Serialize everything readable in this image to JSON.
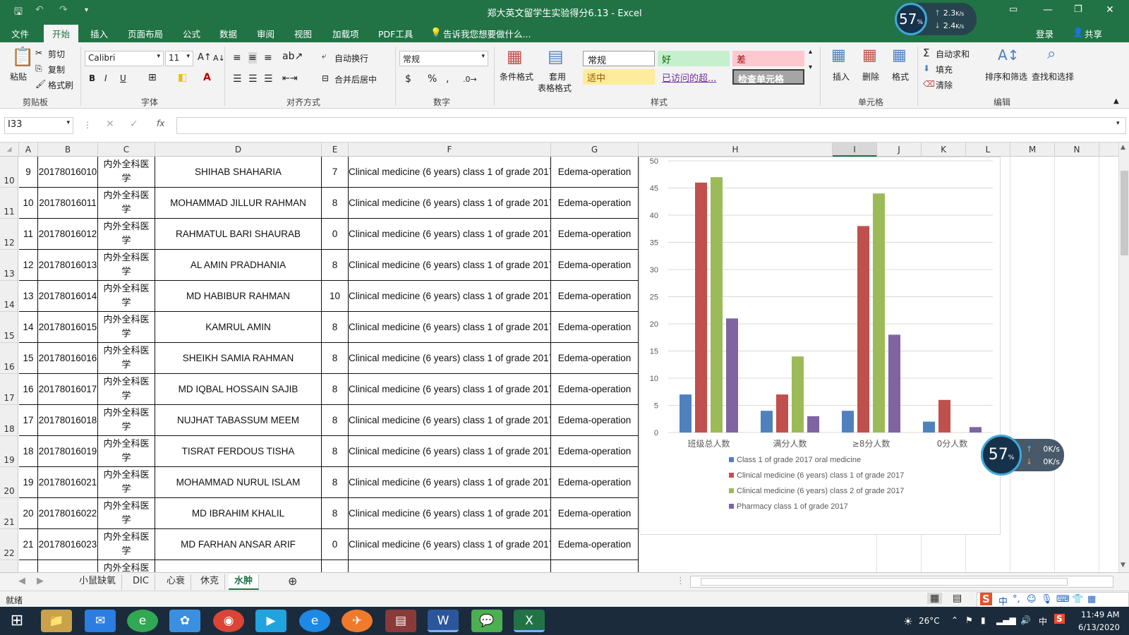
{
  "title_bar": {
    "window_title": "郑大英文留学生实验得分6.13 - Excel",
    "login": "登录",
    "share": "共享"
  },
  "ribbon_tabs": [
    "文件",
    "开始",
    "插入",
    "页面布局",
    "公式",
    "数据",
    "审阅",
    "视图",
    "加载项",
    "PDF工具"
  ],
  "tell_me": "告诉我您想要做什么...",
  "clipboard": {
    "paste": "粘贴",
    "cut": "剪切",
    "copy": "复制",
    "format_painter": "格式刷",
    "group": "剪贴板"
  },
  "font": {
    "name": "Calibri",
    "size": "11",
    "group": "字体",
    "bold": "B",
    "italic": "I",
    "underline": "U"
  },
  "alignment": {
    "wrap": "自动换行",
    "merge": "合并后居中",
    "group": "对齐方式"
  },
  "number": {
    "format": "常规",
    "group": "数字",
    "currency": "$",
    "percent": "%",
    "comma": ","
  },
  "styles_group": {
    "conditional": "条件格式",
    "table_format_1": "套用",
    "table_format_2": "表格格式",
    "normal": "常规",
    "good": "好",
    "bad": "差",
    "neutral": "适中",
    "visited": "已访问的超...",
    "check": "检查单元格",
    "group": "样式"
  },
  "cells": {
    "insert": "插入",
    "delete": "删除",
    "format": "格式",
    "group": "单元格"
  },
  "editing": {
    "autosum": "自动求和",
    "fill": "填充",
    "clear": "清除",
    "sort": "排序和筛选",
    "find": "查找和选择",
    "group": "编辑"
  },
  "formula_bar": {
    "name_box": "I33",
    "fx": "fx",
    "value": ""
  },
  "columns": [
    "A",
    "B",
    "C",
    "D",
    "E",
    "F",
    "G",
    "H",
    "I",
    "J",
    "K",
    "L",
    "M",
    "N"
  ],
  "rows": [
    {
      "row": "10",
      "a": "9",
      "b": "20178016010",
      "c1": "内外全科医",
      "c2": "学",
      "d": "SHIHAB SHAHARIA",
      "e": "7",
      "f": "Clinical medicine (6 years) class 1 of grade 2017",
      "g": "Edema-operation"
    },
    {
      "row": "11",
      "a": "10",
      "b": "20178016011",
      "c1": "内外全科医",
      "c2": "学",
      "d": "MOHAMMAD JILLUR RAHMAN",
      "e": "8",
      "f": "Clinical medicine (6 years) class 1 of grade 2017",
      "g": "Edema-operation"
    },
    {
      "row": "12",
      "a": "11",
      "b": "20178016012",
      "c1": "内外全科医",
      "c2": "学",
      "d": "RAHMATUL BARI SHAURAB",
      "e": "0",
      "f": "Clinical medicine (6 years) class 1 of grade 2017",
      "g": "Edema-operation"
    },
    {
      "row": "13",
      "a": "12",
      "b": "20178016013",
      "c1": "内外全科医",
      "c2": "学",
      "d": "AL AMIN PRADHANIA",
      "e": "8",
      "f": "Clinical medicine (6 years) class 1 of grade 2017",
      "g": "Edema-operation"
    },
    {
      "row": "14",
      "a": "13",
      "b": "20178016014",
      "c1": "内外全科医",
      "c2": "学",
      "d": "MD HABIBUR RAHMAN",
      "e": "10",
      "f": "Clinical medicine (6 years) class 1 of grade 2017",
      "g": "Edema-operation"
    },
    {
      "row": "15",
      "a": "14",
      "b": "20178016015",
      "c1": "内外全科医",
      "c2": "学",
      "d": "KAMRUL AMIN",
      "e": "8",
      "f": "Clinical medicine (6 years) class 1 of grade 2017",
      "g": "Edema-operation"
    },
    {
      "row": "16",
      "a": "15",
      "b": "20178016016",
      "c1": "内外全科医",
      "c2": "学",
      "d": "SHEIKH SAMIA RAHMAN",
      "e": "8",
      "f": "Clinical medicine (6 years) class 1 of grade 2017",
      "g": "Edema-operation"
    },
    {
      "row": "17",
      "a": "16",
      "b": "20178016017",
      "c1": "内外全科医",
      "c2": "学",
      "d": "MD IQBAL HOSSAIN SAJIB",
      "e": "8",
      "f": "Clinical medicine (6 years) class 1 of grade 2017",
      "g": "Edema-operation"
    },
    {
      "row": "18",
      "a": "17",
      "b": "20178016018",
      "c1": "内外全科医",
      "c2": "学",
      "d": "NUJHAT TABASSUM MEEM",
      "e": "8",
      "f": "Clinical medicine (6 years) class 1 of grade 2017",
      "g": "Edema-operation"
    },
    {
      "row": "19",
      "a": "18",
      "b": "20178016019",
      "c1": "内外全科医",
      "c2": "学",
      "d": "TISRAT FERDOUS TISHA",
      "e": "8",
      "f": "Clinical medicine (6 years) class 1 of grade 2017",
      "g": "Edema-operation"
    },
    {
      "row": "20",
      "a": "19",
      "b": "20178016021",
      "c1": "内外全科医",
      "c2": "学",
      "d": "MOHAMMAD NURUL ISLAM",
      "e": "8",
      "f": "Clinical medicine (6 years) class 1 of grade 2017",
      "g": "Edema-operation"
    },
    {
      "row": "21",
      "a": "20",
      "b": "20178016022",
      "c1": "内外全科医",
      "c2": "学",
      "d": "MD IBRAHIM KHALIL",
      "e": "8",
      "f": "Clinical medicine (6 years) class 1 of grade 2017",
      "g": "Edema-operation"
    },
    {
      "row": "22",
      "a": "21",
      "b": "20178016023",
      "c1": "内外全科医",
      "c2": "学",
      "d": "MD FARHAN ANSAR ARIF",
      "e": "0",
      "f": "Clinical medicine (6 years) class 1 of grade 2017",
      "g": "Edema-operation"
    },
    {
      "row": "",
      "a": "",
      "b": "",
      "c1": "内外全科医",
      "c2": "",
      "d": "",
      "e": "",
      "f": "",
      "g": ""
    }
  ],
  "chart_data": {
    "type": "bar",
    "categories": [
      "班级总人数",
      "满分人数",
      "≥8分人数",
      "0分人数"
    ],
    "series": [
      {
        "name": "Class 1 of grade 2017 oral medicine",
        "color": "#4F81BD",
        "values": [
          7,
          4,
          4,
          2
        ]
      },
      {
        "name": "Clinical medicine (6 years) class 1 of grade 2017",
        "color": "#C0504D",
        "values": [
          46,
          7,
          38,
          6
        ]
      },
      {
        "name": "Clinical medicine (6 years) class 2 of grade 2017",
        "color": "#9BBB59",
        "values": [
          47,
          14,
          44,
          0
        ]
      },
      {
        "name": "Pharmacy class 1 of grade 2017",
        "color": "#8064A2",
        "values": [
          21,
          3,
          18,
          1
        ]
      }
    ],
    "yticks": [
      "0",
      "5",
      "10",
      "15",
      "20",
      "25",
      "30",
      "35",
      "40",
      "45",
      "50"
    ],
    "ylim": [
      0,
      50
    ],
    "grid": true,
    "legend": "bottom"
  },
  "sheet_tabs": [
    "小鼠缺氧",
    "DIC",
    "心衰",
    "休克",
    "水肿"
  ],
  "active_sheet": "水肿",
  "status": {
    "ready": "就绪"
  },
  "net_monitor_top": {
    "percent": "57",
    "unit": "%",
    "up": "2.3",
    "down": "2.4",
    "rate_unit": "K/s"
  },
  "net_monitor_mid": {
    "percent": "57",
    "unit": "%",
    "up": "0",
    "down": "0",
    "rate_unit": "K/s"
  },
  "taskbar": {
    "temp": "26°C",
    "ime": "中",
    "time": "11:49 AM",
    "date": "6/13/2020"
  }
}
